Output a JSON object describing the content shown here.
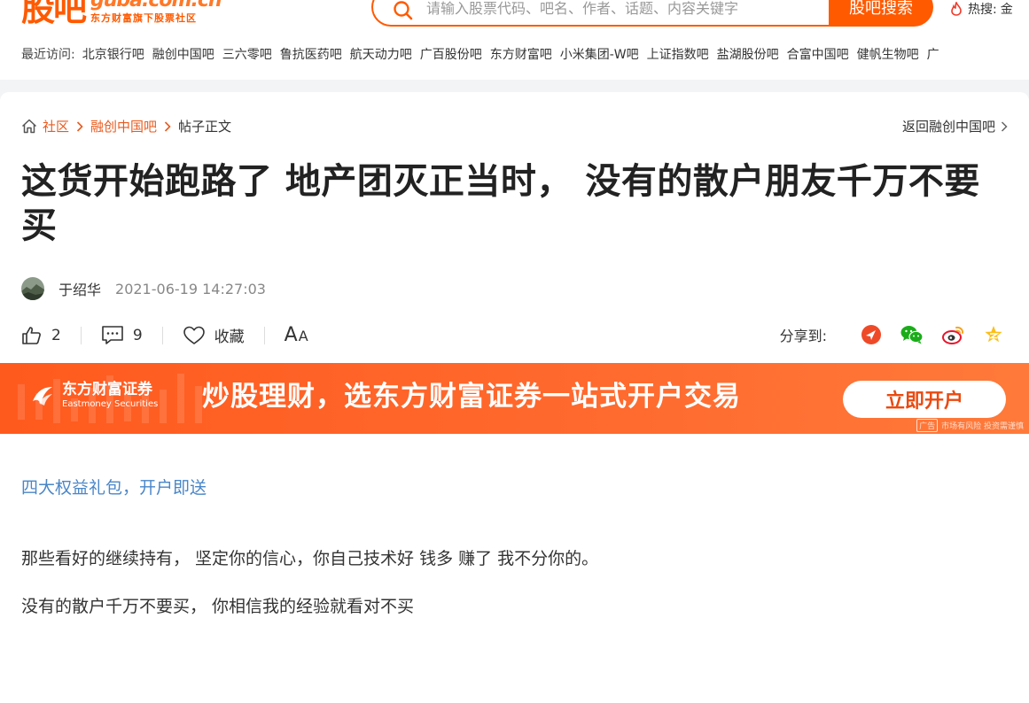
{
  "header": {
    "logo_cn": "股吧",
    "logo_en": "guba.com.cn",
    "logo_sub": "东方财富旗下股票社区",
    "search_placeholder": "请输入股票代码、吧名、作者、话题、内容关键字",
    "search_button": "股吧搜索",
    "hot_label": "热搜:",
    "hot_keyword": "金"
  },
  "recent": {
    "label": "最近访问:",
    "items": [
      "北京银行吧",
      "融创中国吧",
      "三六零吧",
      "鲁抗医药吧",
      "航天动力吧",
      "广百股份吧",
      "东方财富吧",
      "小米集团-W吧",
      "上证指数吧",
      "盐湖股份吧",
      "合富中国吧",
      "健帆生物吧",
      "广"
    ]
  },
  "breadcrumb": {
    "items": [
      "社区",
      "融创中国吧"
    ],
    "current": "帖子正文",
    "back_link": "返回融创中国吧"
  },
  "post": {
    "title": "这货开始跑路了 地产团灭正当时， 没有的散户朋友千万不要买",
    "author": "于绍华",
    "time": "2021-06-19 14:27:03",
    "likes": "2",
    "comments": "9",
    "favorite_label": "收藏",
    "font_big": "A",
    "font_small": "A",
    "share_label": "分享到:"
  },
  "banner": {
    "logo_cn": "东方财富证券",
    "logo_en": "Eastmoney Securities",
    "slogan": "炒股理财，选东方财富证券一站式开户交易",
    "button": "立即开户",
    "ad_tag": "广告",
    "ad_note": "市场有风险 投资需谨慎"
  },
  "body": {
    "promo_link": "四大权益礼包，开户即送",
    "paragraphs": [
      "那些看好的继续持有， 坚定你的信心，你自己技术好 钱多 赚了 我不分你的。",
      "没有的散户千万不要买， 你相信我的经验就看对不买"
    ]
  },
  "colors": {
    "brand": "#ff5a00",
    "link": "#4a86c8",
    "banner": "#ff5a1e"
  },
  "icons": {
    "share": [
      "toutiao-icon",
      "wechat-icon",
      "weibo-icon",
      "qzone-icon"
    ]
  }
}
